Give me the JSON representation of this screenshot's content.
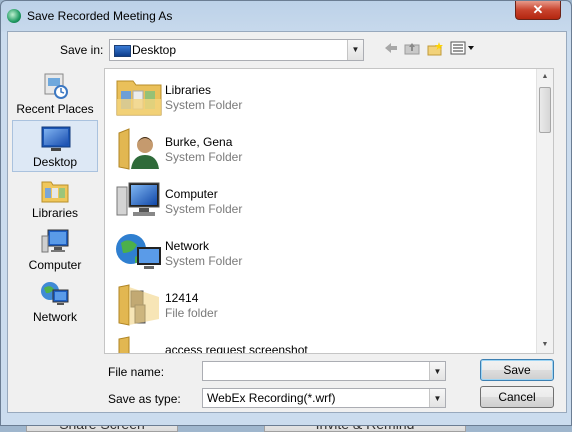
{
  "window": {
    "title": "Save Recorded Meeting As",
    "close_glyph": "✕"
  },
  "save_in": {
    "label": "Save in:",
    "value": "Desktop"
  },
  "toolbar": {
    "back_icon": "back-arrow-icon",
    "up_icon": "up-folder-icon",
    "new_folder_icon": "new-folder-icon",
    "view_icon": "view-menu-icon"
  },
  "places": [
    {
      "label": "Recent Places",
      "icon": "recent-places-icon"
    },
    {
      "label": "Desktop",
      "icon": "desktop-icon",
      "selected": true
    },
    {
      "label": "Libraries",
      "icon": "libraries-icon"
    },
    {
      "label": "Computer",
      "icon": "computer-icon"
    },
    {
      "label": "Network",
      "icon": "network-icon"
    }
  ],
  "files": [
    {
      "name": "Libraries",
      "type": "System Folder",
      "icon": "libraries-folder-icon"
    },
    {
      "name": "Burke, Gena",
      "type": "System Folder",
      "icon": "user-folder-icon"
    },
    {
      "name": "Computer",
      "type": "System Folder",
      "icon": "computer-icon"
    },
    {
      "name": "Network",
      "type": "System Folder",
      "icon": "network-icon"
    },
    {
      "name": "12414",
      "type": "File folder",
      "icon": "folder-icon"
    },
    {
      "name": "access request screenshot",
      "type": "",
      "icon": "folder-icon"
    }
  ],
  "file_name": {
    "label": "File name:",
    "value": ""
  },
  "save_as_type": {
    "label": "Save as type:",
    "value": "WebEx Recording(*.wrf)"
  },
  "buttons": {
    "save": "Save",
    "cancel": "Cancel"
  },
  "background": {
    "left_button": "Share Screen",
    "right_button": "Invite & Remind"
  }
}
